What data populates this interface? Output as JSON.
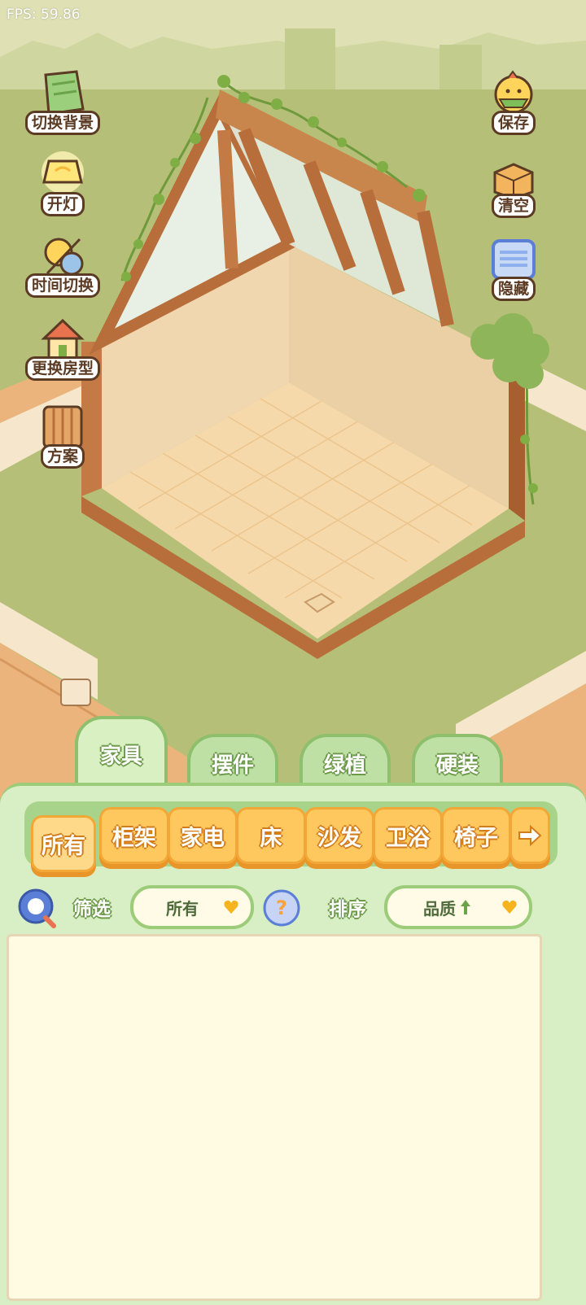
{
  "fps": "FPS: 59.86",
  "left_buttons": [
    {
      "label": "切换背景",
      "icon": "wallpaper-icon"
    },
    {
      "label": "开灯",
      "icon": "lamp-icon"
    },
    {
      "label": "时间切换",
      "icon": "sun-moon-icon"
    },
    {
      "label": "更换房型",
      "icon": "house-icon"
    },
    {
      "label": "方案",
      "icon": "scroll-icon"
    }
  ],
  "right_buttons": [
    {
      "label": "保存",
      "icon": "chick-icon"
    },
    {
      "label": "清空",
      "icon": "cardboard-box-icon"
    },
    {
      "label": "隐藏",
      "icon": "hide-frame-icon"
    }
  ],
  "tabs": [
    "家具",
    "摆件",
    "绿植",
    "硬装"
  ],
  "categories": [
    "所有",
    "柜架",
    "家电",
    "床",
    "沙发",
    "卫浴",
    "椅子"
  ],
  "filter": {
    "label": "筛选",
    "value": "所有"
  },
  "sort": {
    "label": "排序",
    "value": "品质"
  },
  "colors": {
    "wood": "#b86e3b",
    "wall": "#f0d6b0",
    "panel_green": "#d8eec4",
    "orange_button": "#ffc85e"
  }
}
